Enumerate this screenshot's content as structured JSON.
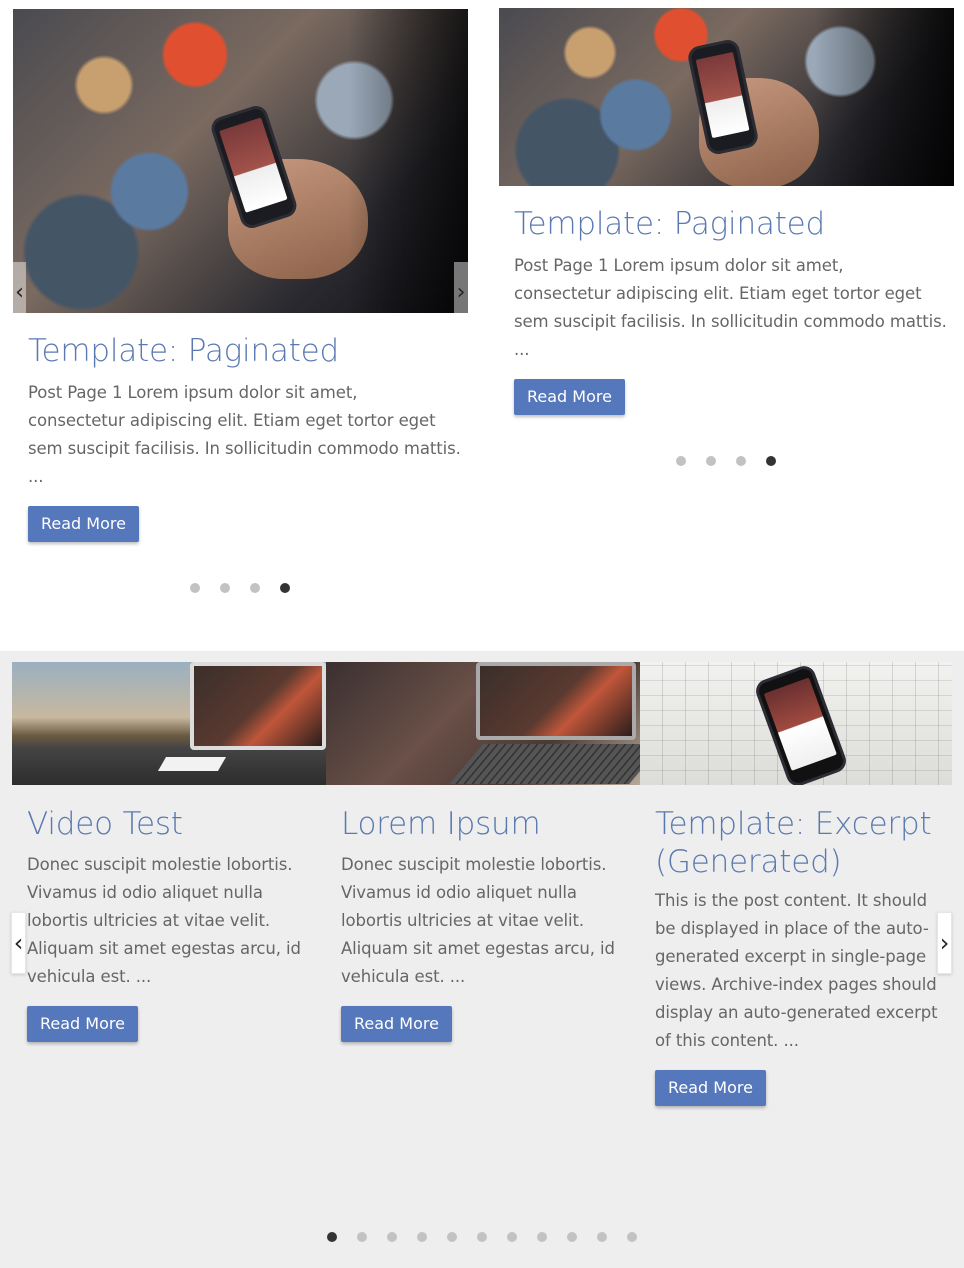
{
  "carousel1": {
    "title": "Template: Paginated",
    "excerpt_lines": [
      "Post Page 1 Lorem ipsum dolor sit amet,",
      "consectetur adipiscing elit. Etiam eget tortor eget",
      "sem suscipit facilisis. In sollicitudin commodo mattis.",
      "..."
    ],
    "button": "Read More",
    "prev_icon": "chevron-left-icon",
    "next_icon": "chevron-right-icon",
    "dots_total": 4,
    "active_dot": 4
  },
  "carousel2": {
    "title": "Template: Paginated",
    "excerpt_lines": [
      "Post Page 1 Lorem ipsum dolor sit amet,",
      "consectetur adipiscing elit. Etiam eget tortor eget",
      "sem suscipit facilisis. In sollicitudin commodo mattis.",
      "..."
    ],
    "button": "Read More",
    "dots_total": 4,
    "active_dot": 4
  },
  "carousel3": {
    "prev_icon": "chevron-left-icon",
    "next_icon": "chevron-right-icon",
    "cards": [
      {
        "title_lines": [
          "Video Test"
        ],
        "excerpt_lines": [
          "Donec suscipit molestie lobortis.",
          "Vivamus id odio aliquet nulla",
          "lobortis ultricies at vitae velit.",
          "Aliquam sit amet egestas arcu, id",
          "vehicula est. ..."
        ],
        "button": "Read More"
      },
      {
        "title_lines": [
          "Lorem Ipsum"
        ],
        "excerpt_lines": [
          "Donec suscipit molestie lobortis.",
          "Vivamus id odio aliquet nulla",
          "lobortis ultricies at vitae velit.",
          "Aliquam sit amet egestas arcu, id",
          "vehicula est. ..."
        ],
        "button": "Read More"
      },
      {
        "title_lines": [
          "Template: Excerpt",
          "(Generated)"
        ],
        "excerpt_lines": [
          "This is the post content. It should",
          "be displayed in place of the auto-",
          "generated excerpt in single-page",
          "views. Archive-index pages should",
          "display an auto-generated excerpt",
          "of this content. ..."
        ],
        "button": "Read More"
      }
    ],
    "dots_total": 11,
    "active_dot": 1
  },
  "colors": {
    "title": "#5a79b0",
    "button": "#5577bb",
    "band": "#eeeeee",
    "dot": "#c2c2c2",
    "dot_active": "#333333"
  }
}
